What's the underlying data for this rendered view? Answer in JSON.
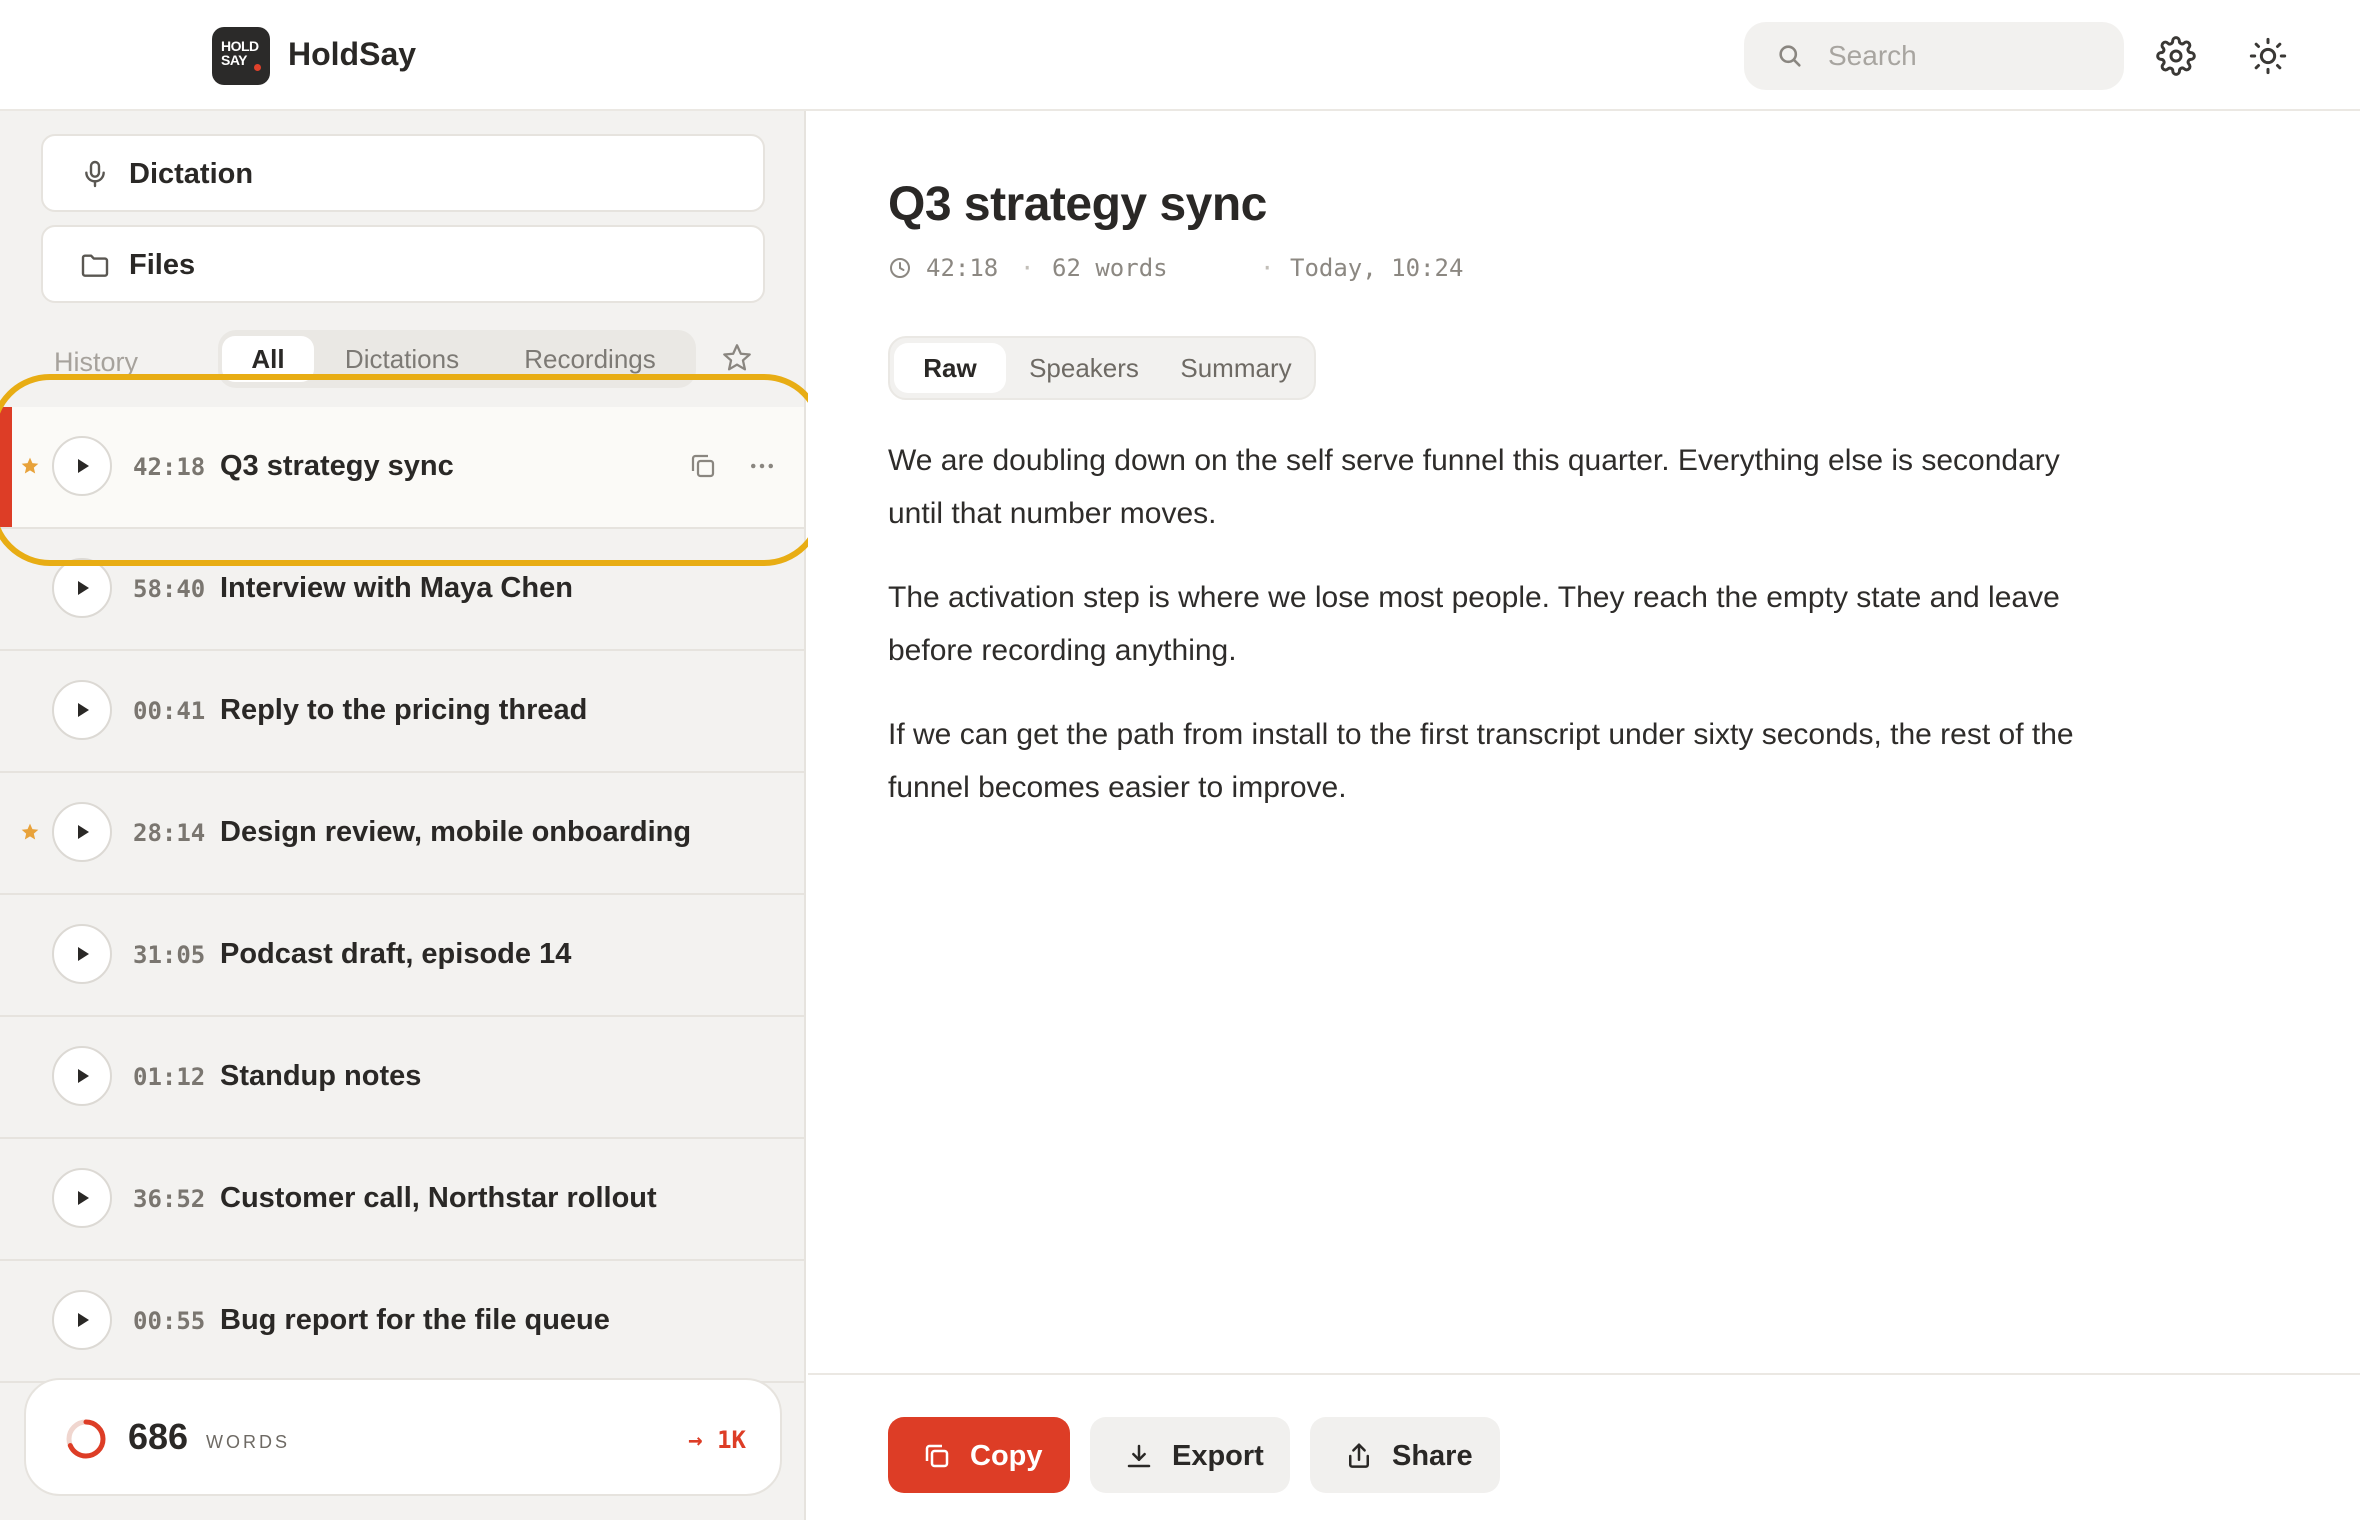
{
  "app": {
    "name": "HoldSay",
    "logo_line1": "HOLD",
    "logo_line2": "SAY"
  },
  "header": {
    "search_placeholder": "Search",
    "icons": [
      "search-icon",
      "gear-icon",
      "sun-icon"
    ]
  },
  "sidebar": {
    "nav": [
      {
        "label": "Dictation",
        "icon": "microphone-icon"
      },
      {
        "label": "Files",
        "icon": "folder-icon"
      }
    ],
    "history_label": "History",
    "filters": [
      "All",
      "Dictations",
      "Recordings"
    ],
    "active_filter": "All",
    "items": [
      {
        "duration": "42:18",
        "title": "Q3 strategy sync",
        "starred": true,
        "selected": true
      },
      {
        "duration": "58:40",
        "title": "Interview with Maya Chen",
        "starred": false,
        "selected": false
      },
      {
        "duration": "00:41",
        "title": "Reply to the pricing thread",
        "starred": false,
        "selected": false
      },
      {
        "duration": "28:14",
        "title": "Design review, mobile onboarding",
        "starred": true,
        "selected": false
      },
      {
        "duration": "31:05",
        "title": "Podcast draft, episode 14",
        "starred": false,
        "selected": false
      },
      {
        "duration": "01:12",
        "title": "Standup notes",
        "starred": false,
        "selected": false
      },
      {
        "duration": "36:52",
        "title": "Customer call, Northstar rollout",
        "starred": false,
        "selected": false
      },
      {
        "duration": "00:55",
        "title": "Bug report for the file queue",
        "starred": false,
        "selected": false
      }
    ],
    "footer": {
      "word_count": "686",
      "word_unit": "WORDS",
      "goal": "→ 1K",
      "progress": 0.686
    }
  },
  "main": {
    "title": "Q3 strategy sync",
    "meta": {
      "duration": "42:18",
      "words": "62 words",
      "date": "Today, 10:24",
      "separator": "·"
    },
    "views": [
      "Raw",
      "Speakers",
      "Summary"
    ],
    "active_view": "Raw",
    "paragraphs": [
      "We are doubling down on the self serve funnel this quarter. Everything else is secondary until that number moves.",
      "The activation step is where we lose most people. They reach the empty state and leave before recording anything.",
      "If we can get the path from install to the first transcript under sixty seconds, the rest of the funnel becomes easier to improve."
    ],
    "actions": {
      "copy": "Copy",
      "export": "Export",
      "share": "Share"
    }
  },
  "colors": {
    "accent": "#dd3d26",
    "star": "#e8a23a",
    "highlight": "#e8ad14",
    "sidebar_bg": "#f3f2f0"
  }
}
